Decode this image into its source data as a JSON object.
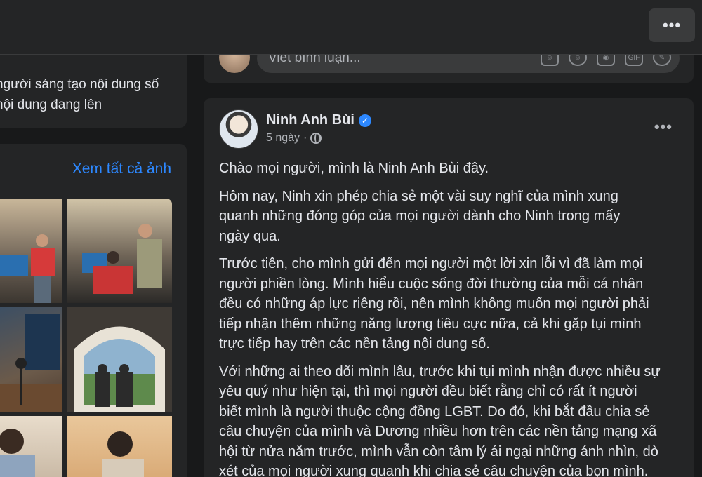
{
  "topbar": {
    "more_label": "•••"
  },
  "intro": {
    "lines": [
      "người sáng tạo nội dung số",
      "nội dung đang lên"
    ]
  },
  "photos": {
    "see_all": "Xem tất cả ảnh"
  },
  "comment_box": {
    "placeholder": "Viết bình luận...",
    "icons": [
      "sticker-icon",
      "emoji-icon",
      "camera-icon",
      "gif-icon",
      "sticker-leaf-icon"
    ]
  },
  "post": {
    "author": "Ninh Anh Bùi",
    "time": "5 ngày",
    "audience": "public",
    "more_label": "•••",
    "paragraphs": [
      [
        "Chào mọi người, mình là Ninh Anh Bùi đây."
      ],
      [
        "Hôm nay, Ninh xin phép chia sẻ một vài suy nghĩ của mình xung",
        "quanh những đóng góp của mọi người dành cho Ninh trong mấy",
        "ngày qua."
      ],
      [
        "Trước tiên, cho mình gửi đến mọi người một lời xin lỗi vì đã làm mọi",
        "người phiền lòng. Mình hiểu cuộc sống đời thường của mỗi cá nhân",
        "đều có những áp lực riêng rồi, nên mình không muốn mọi người phải",
        "tiếp nhận thêm những năng lượng tiêu cực nữa, cả khi gặp tụi mình",
        "trực tiếp hay trên các nền tảng nội dung số."
      ],
      [
        "Với những ai theo dõi mình lâu, trước khi tụi mình nhận được nhiều sự",
        "yêu quý như hiện tại, thì mọi người đều biết rằng chỉ có rất ít người",
        "biết mình là người thuộc cộng đồng LGBT. Do đó, khi bắt đầu chia sẻ",
        "câu chuyện của mình và Dương nhiều hơn trên các nền tảng mạng xã",
        "hội từ nửa năm trước, mình vẫn còn tâm lý ái ngại những ánh nhìn, dò",
        "xét của mọi người xung quanh khi chia sẻ câu chuyện của bọn mình."
      ]
    ]
  }
}
